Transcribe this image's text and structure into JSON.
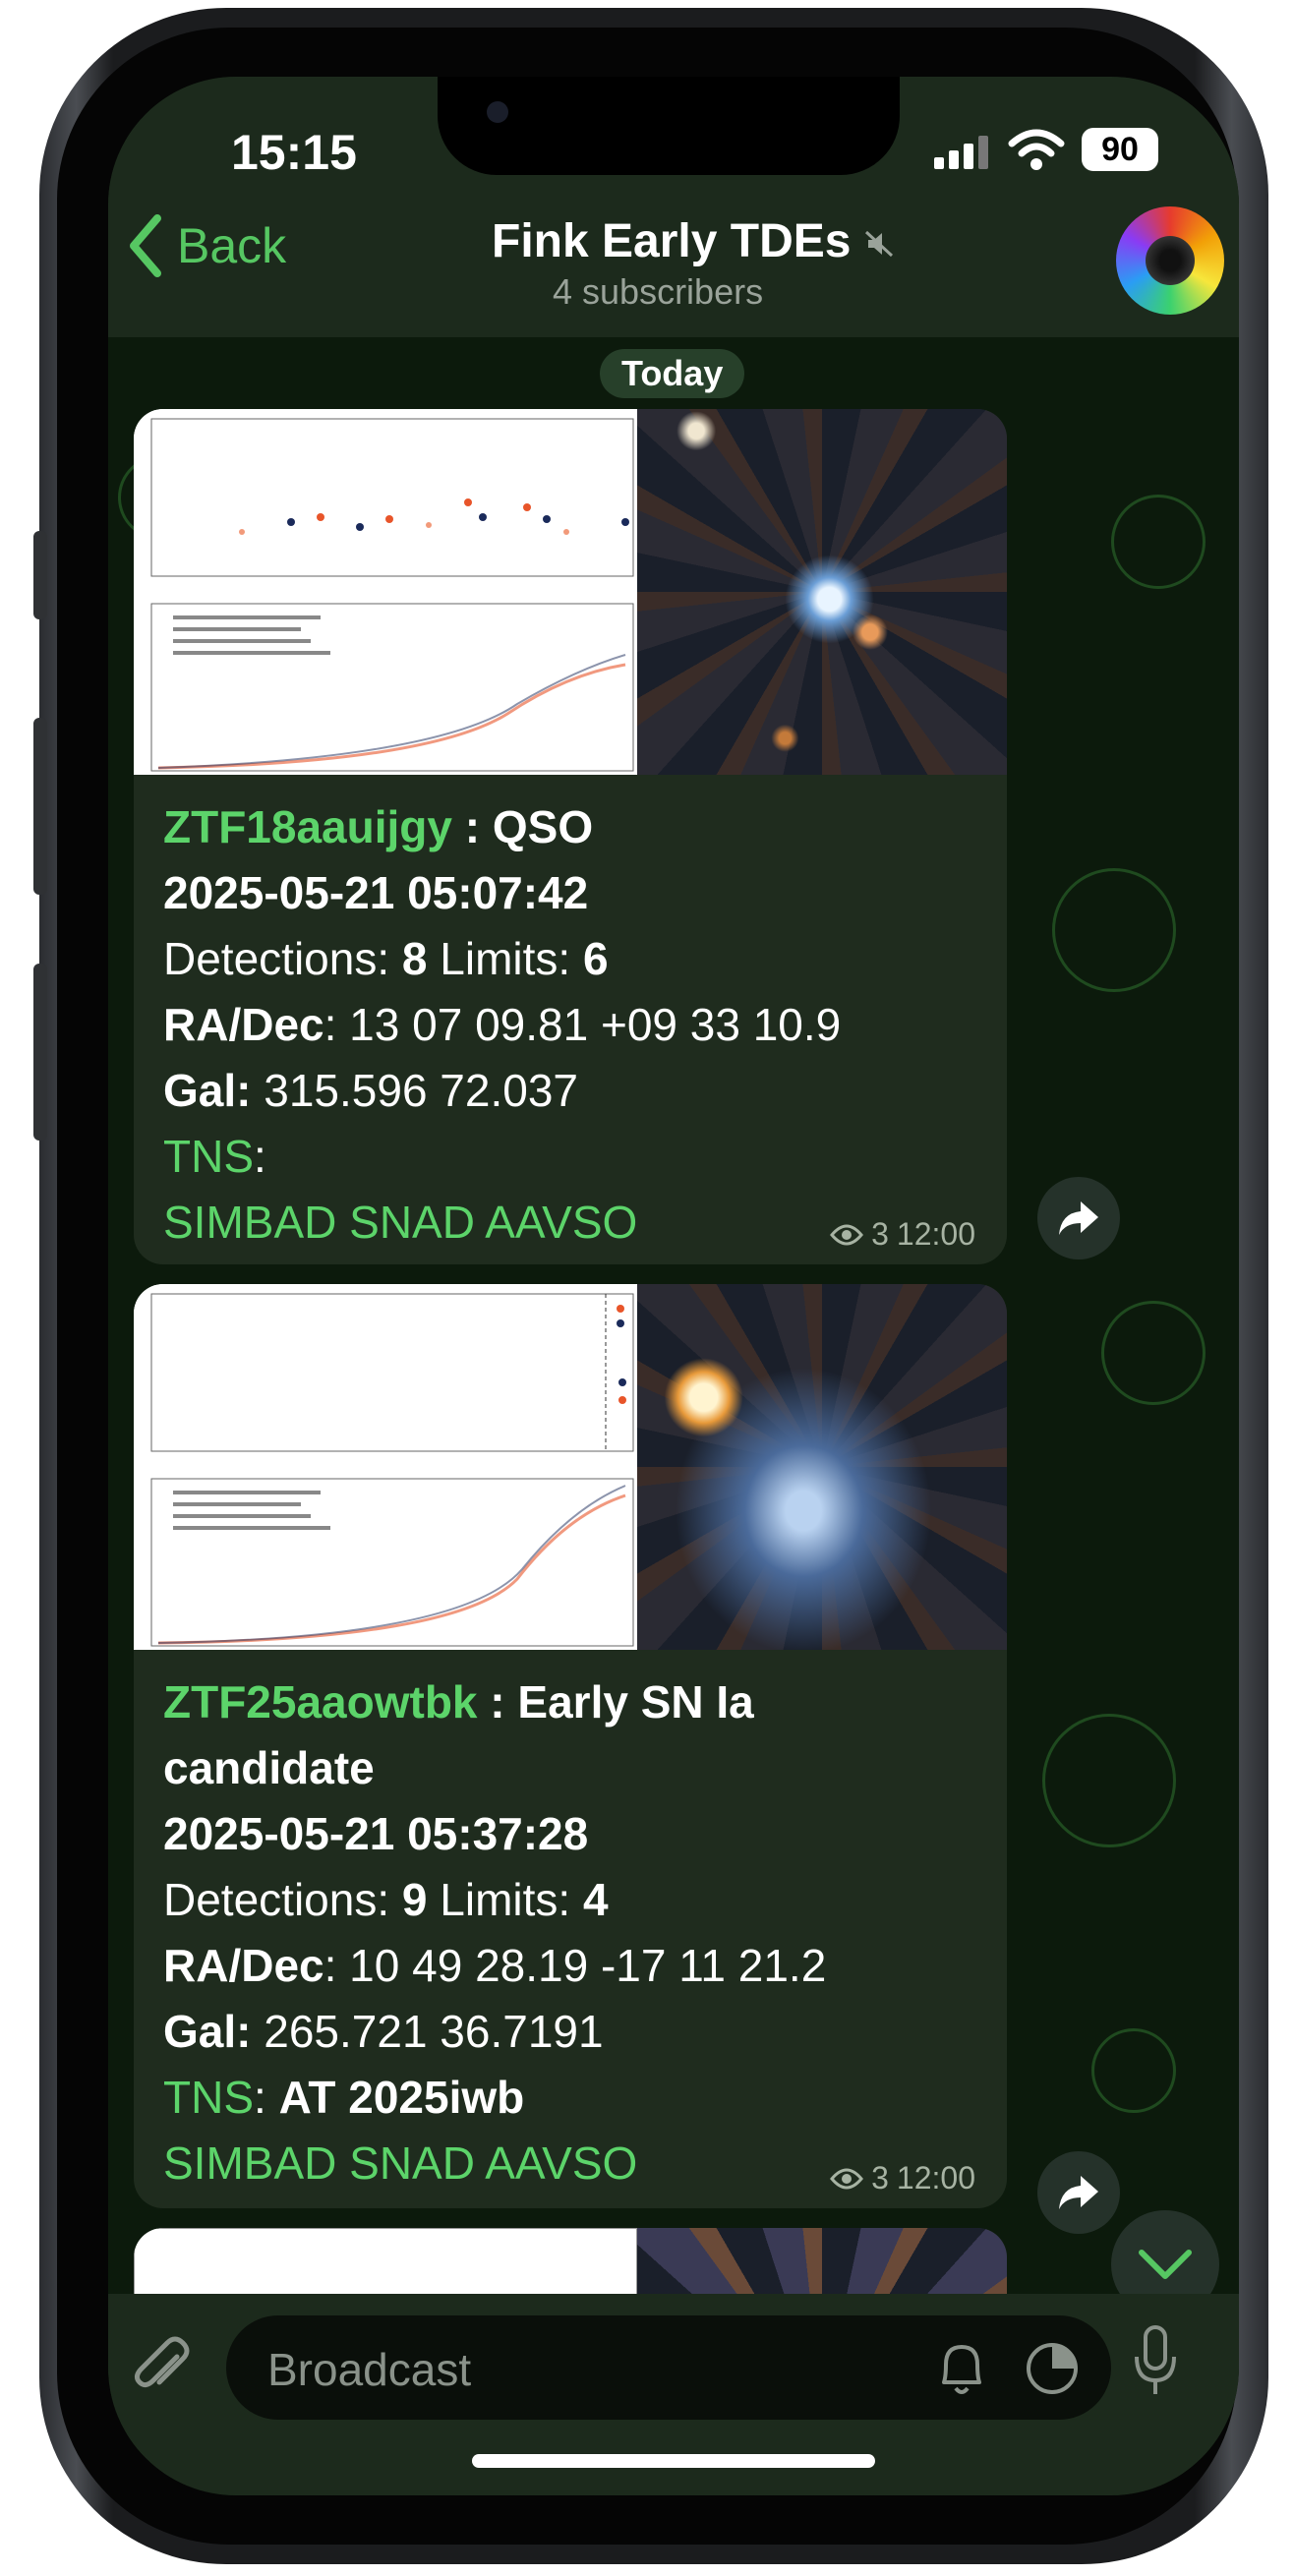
{
  "status": {
    "time": "15:15",
    "battery": "90"
  },
  "header": {
    "back_label": "Back",
    "title": "Fink Early TDEs",
    "subtitle": "4 subscribers"
  },
  "chat": {
    "date_label": "Today"
  },
  "messages": [
    {
      "object_id": "ZTF18aauijgy",
      "classification": "QSO",
      "datetime": "2025-05-21 05:07:42",
      "detections_label": "Detections:",
      "detections": "8",
      "limits_label": "Limits:",
      "limits": "6",
      "radec_label": "RA/Dec",
      "radec": "13 07 09.81 +09 33 10.9",
      "gal_label": "Gal:",
      "gal": "315.596 72.037",
      "tns_label": "TNS",
      "tns": "",
      "links": [
        "SIMBAD",
        "SNAD",
        "AAVSO"
      ],
      "views": "3",
      "time": "12:00"
    },
    {
      "object_id": "ZTF25aaowtbk",
      "classification_line1": "Early SN Ia",
      "classification_line2": "candidate",
      "datetime": "2025-05-21 05:37:28",
      "detections_label": "Detections:",
      "detections": "9",
      "limits_label": "Limits:",
      "limits": "4",
      "radec_label": "RA/Dec",
      "radec": "10 49 28.19 -17 11 21.2",
      "gal_label": "Gal:",
      "gal": "265.721 36.7191",
      "tns_label": "TNS",
      "tns": "AT 2025iwb",
      "links": [
        "SIMBAD",
        "SNAD",
        "AAVSO"
      ],
      "views": "3",
      "time": "12:00"
    }
  ],
  "input": {
    "placeholder": "Broadcast"
  },
  "colors": {
    "accent": "#5cd46a",
    "bubble": "#1f2c1e",
    "background": "#0c1a0c"
  }
}
